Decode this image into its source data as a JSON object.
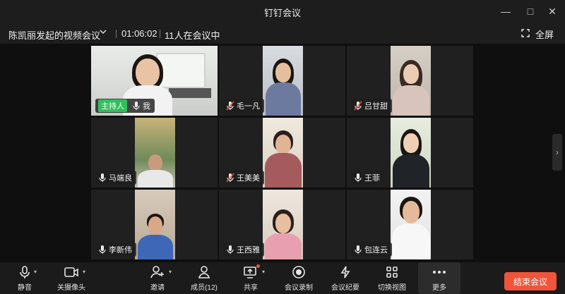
{
  "window": {
    "title": "钉钉会议"
  },
  "infobar": {
    "meeting_name": "陈凯丽发起的视频会议",
    "timer": "01:06:02",
    "participant_count": "11人在会议中",
    "fullscreen_label": "全屏"
  },
  "tiles": [
    {
      "name": "我",
      "host_badge": "主持人",
      "muted": false
    },
    {
      "name": "毛一凡",
      "muted": true
    },
    {
      "name": "吕甘甜",
      "muted": true
    },
    {
      "name": "马端良",
      "muted": false
    },
    {
      "name": "王美美",
      "muted": true
    },
    {
      "name": "王菲",
      "muted": false
    },
    {
      "name": "李新伟",
      "muted": false
    },
    {
      "name": "王西雅",
      "muted": false
    },
    {
      "name": "包连云",
      "muted": false
    }
  ],
  "toolbar": {
    "mute": "静音",
    "camera_off": "关摄像头",
    "invite": "邀请",
    "members": "成员(12)",
    "share": "共享",
    "record": "会议录制",
    "minutes": "会议纪要",
    "switch_view": "切换视图",
    "more": "更多",
    "end": "结束会议"
  },
  "colors": {
    "host_badge": "#2fbf5b",
    "end_button": "#f0543a",
    "muted_mic": "#f0543a"
  },
  "icons": [
    "minimize-icon",
    "maximize-icon",
    "close-icon",
    "chevron-down-icon",
    "fullscreen-icon",
    "mic-icon",
    "mic-muted-icon",
    "camera-icon",
    "add-person-icon",
    "members-icon",
    "share-screen-icon",
    "record-icon",
    "minutes-icon",
    "grid-view-icon",
    "more-icon"
  ]
}
